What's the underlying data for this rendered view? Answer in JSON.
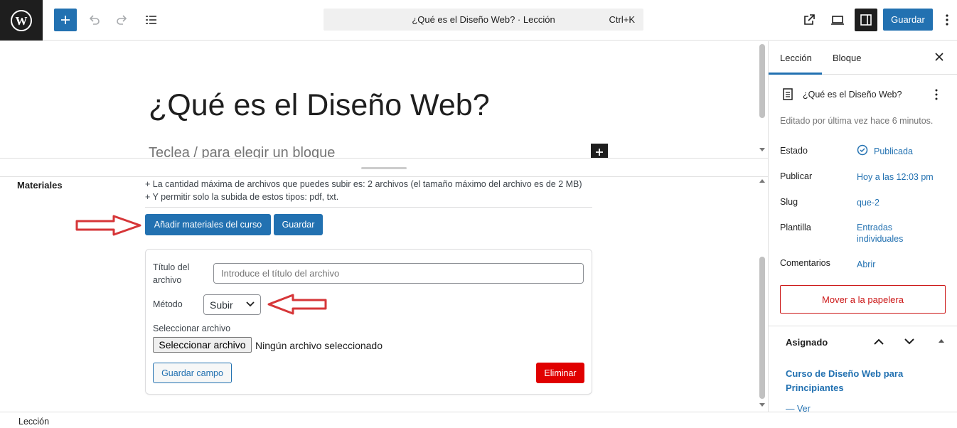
{
  "toolbar": {
    "command_bar_text": "¿Qué es el Diseño Web? · Lección",
    "command_shortcut": "Ctrl+K",
    "save_label": "Guardar"
  },
  "editor": {
    "post_title": "¿Qué es el Diseño Web?",
    "block_placeholder": "Teclea / para elegir un bloque"
  },
  "metabox": {
    "label": "Materiales",
    "info_line_1": "+ La cantidad máxima de archivos que puedes subir es: 2 archivos (el tamaño máximo del archivo es de 2 MB)",
    "info_line_2": "+ Y permitir solo la subida de estos tipos: pdf, txt.",
    "add_materials_label": "Añadir materiales del curso",
    "save_label": "Guardar",
    "file_title_label": "Título del archivo",
    "file_title_placeholder": "Introduce el título del archivo",
    "method_label": "Método",
    "method_value": "Subir",
    "select_file_label": "Seleccionar archivo",
    "select_file_button": "Seleccionar archivo",
    "no_file_text": "Ningún archivo seleccionado",
    "save_field_label": "Guardar campo",
    "delete_label": "Eliminar"
  },
  "footer": {
    "breadcrumb": "Lección"
  },
  "sidebar": {
    "tabs": [
      {
        "label": "Lección"
      },
      {
        "label": "Bloque"
      }
    ],
    "doc_title": "¿Qué es el Diseño Web?",
    "edited_text": "Editado por última vez hace 6 minutos.",
    "rows": {
      "estado_label": "Estado",
      "estado_value": "Publicada",
      "publicar_label": "Publicar",
      "publicar_value": "Hoy a las 12:03 pm",
      "slug_label": "Slug",
      "slug_value": "que-2",
      "plantilla_label": "Plantilla",
      "plantilla_value_1": "Entradas",
      "plantilla_value_2": "individuales",
      "comentarios_label": "Comentarios",
      "comentarios_value": "Abrir"
    },
    "trash_label": "Mover a la papelera",
    "assigned_label": "Asignado",
    "course_name": "Curso de Diseño Web para Principiantes",
    "view_link": "— Ver"
  },
  "colors": {
    "accent": "#2271b1",
    "danger": "#e00000",
    "annotation_arrow": "#d63638"
  }
}
